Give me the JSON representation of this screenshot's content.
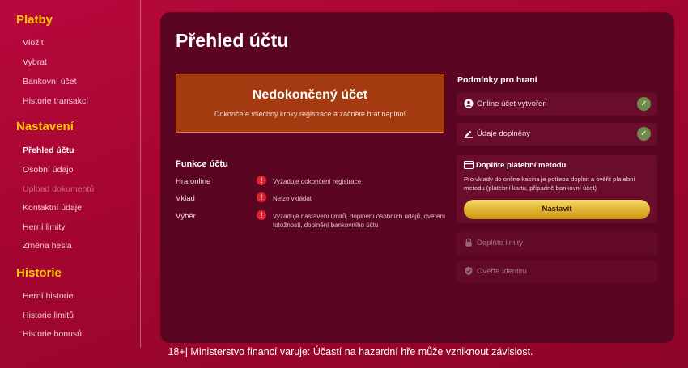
{
  "sidebar": {
    "sections": [
      {
        "title": "Platby",
        "items": [
          "Vložit",
          "Vybrat",
          "Bankovní účet",
          "Historie transakcí"
        ]
      },
      {
        "title": "Nastavení",
        "items": [
          "Přehled účtu",
          "Osobní údajo",
          "Upload dokumentů",
          "Kontaktní údaje",
          "Herní limity",
          "Změna hesla"
        ]
      },
      {
        "title": "Historie",
        "items": [
          "Herní historie",
          "Historie limitů",
          "Historie bonusů"
        ]
      }
    ]
  },
  "main": {
    "title": "Přehled účtu",
    "incomplete": {
      "title": "Nedokončený účet",
      "description": "Dokončete všechny kroky registrace a začněte hrát naplno!"
    },
    "features": {
      "title": "Funkce účtu",
      "rows": [
        {
          "name": "Hra online",
          "status": "Vyžaduje dokončení registrace"
        },
        {
          "name": "Vklad",
          "status": "Nelze vkládat"
        },
        {
          "name": "Výběr",
          "status": "Vyžaduje nastavení limitů, doplnění osobních údajů, ověření totožnosti, doplnění bankovního účtu"
        }
      ]
    },
    "conditions": {
      "title": "Podmínky pro hraní",
      "done": [
        {
          "label": "Online účet vytvořen",
          "icon": "user-icon"
        },
        {
          "label": "Údaje doplněny",
          "icon": "pencil-icon"
        }
      ],
      "payment": {
        "title": "Doplňte platební metodu",
        "description": "Pro vklady do online kasina je potřeba doplnit a ověřit platební metodu (platební kartu, případně bankovní účet)",
        "button": "Nastavit"
      },
      "locked": [
        {
          "label": "Doplňte limity",
          "icon": "lock-icon"
        },
        {
          "label": "Ověřte identitu",
          "icon": "shield-icon"
        }
      ]
    }
  },
  "footer": {
    "text": "18+| Ministerstvo financí varuje: Účastí na hazardní hře může vzniknout závislost."
  },
  "colors": {
    "background": "#a3062f",
    "panel": "#5a0622",
    "accent_yellow": "#ffc800",
    "incomplete_box": "#a33a10",
    "check_green": "#6f8a4a",
    "button_gold": "#dcae2a"
  }
}
